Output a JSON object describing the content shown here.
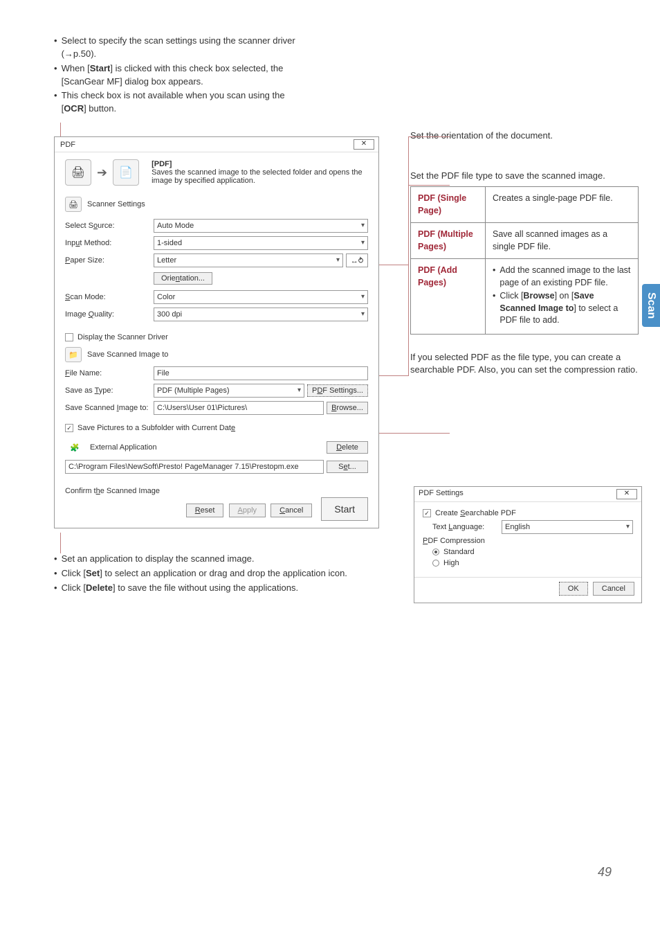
{
  "top_bullets": [
    "Select to specify the scan settings using the scanner driver (→p.50).",
    {
      "prefix": "When [",
      "bold": "Start",
      "suffix": "] is clicked with this check box selected, the [ScanGear MF] dialog box appears."
    },
    {
      "prefix": "This check box is not available when you scan using the [",
      "bold": "OCR",
      "suffix": "] button."
    }
  ],
  "dialog": {
    "title": "PDF",
    "header_title": "[PDF]",
    "header_desc": "Saves the scanned image to the selected folder and opens the image by specified application.",
    "scanner_settings": "Scanner Settings",
    "rows": {
      "select_source": {
        "label": "Select Source:",
        "value": "Auto Mode"
      },
      "input_method": {
        "label": "Input Method:",
        "value": "1-sided"
      },
      "paper_size": {
        "label": "Paper Size:",
        "value": "Letter"
      },
      "orientation": "Orientation...",
      "scan_mode": {
        "label": "Scan Mode:",
        "value": "Color"
      },
      "image_quality": {
        "label": "Image Quality:",
        "value": "300 dpi"
      }
    },
    "display_driver": "Display the Scanner Driver",
    "save_section_title": "Save Scanned Image to",
    "file_name": {
      "label": "File Name:",
      "value": "File"
    },
    "save_as_type": {
      "label": "Save as Type:",
      "value": "PDF (Multiple Pages)"
    },
    "pdf_settings_btn": "PDF Settings...",
    "save_to": {
      "label": "Save Scanned Image to:",
      "value": "C:\\Users\\User 01\\Pictures\\"
    },
    "browse_btn": "Browse...",
    "save_subfolder": "Save Pictures to a Subfolder with Current Date",
    "external_app": "External Application",
    "delete_btn": "Delete",
    "set_btn": "Set...",
    "app_path": "C:\\Program Files\\NewSoft\\Presto! PageManager 7.15\\Prestopm.exe",
    "confirm_image": "Confirm the Scanned Image",
    "reset": "Reset",
    "apply": "Apply",
    "cancel": "Cancel",
    "start": "Start"
  },
  "annotations": {
    "orientation": "Set the orientation of the document.",
    "pdf_type": "Set the PDF file type to save the scanned image.",
    "searchable": "If you selected PDF as the file type, you can create a searchable PDF. Also, you can set the compression ratio."
  },
  "pdf_table": [
    {
      "name": "PDF (Single Page)",
      "desc": "Creates a single-page PDF file."
    },
    {
      "name": "PDF (Multiple Pages)",
      "desc": "Save all scanned images as a single PDF file."
    },
    {
      "name": "PDF (Add Pages)",
      "bullets": [
        "Add the scanned image to the last page of an existing PDF file.",
        {
          "text": "Click [",
          "bold1": "Browse",
          "mid": "] on [",
          "bold2": "Save Scanned Image to",
          "end": "] to select a PDF file to add."
        }
      ]
    }
  ],
  "pdf_settings_dialog": {
    "title": "PDF Settings",
    "create_searchable": "Create Searchable PDF",
    "text_language": {
      "label": "Text Language:",
      "value": "English"
    },
    "pdf_compression": "PDF Compression",
    "standard": "Standard",
    "high": "High",
    "ok": "OK",
    "cancel": "Cancel"
  },
  "bottom_bullets": [
    "Set an application to display the scanned image.",
    {
      "prefix": "Click [",
      "bold": "Set",
      "suffix": "] to select an application or drag and drop the application icon."
    },
    {
      "prefix": "Click [",
      "bold": "Delete",
      "suffix": "] to save the file without using the applications."
    }
  ],
  "side_tab": "Scan",
  "page_num": "49"
}
